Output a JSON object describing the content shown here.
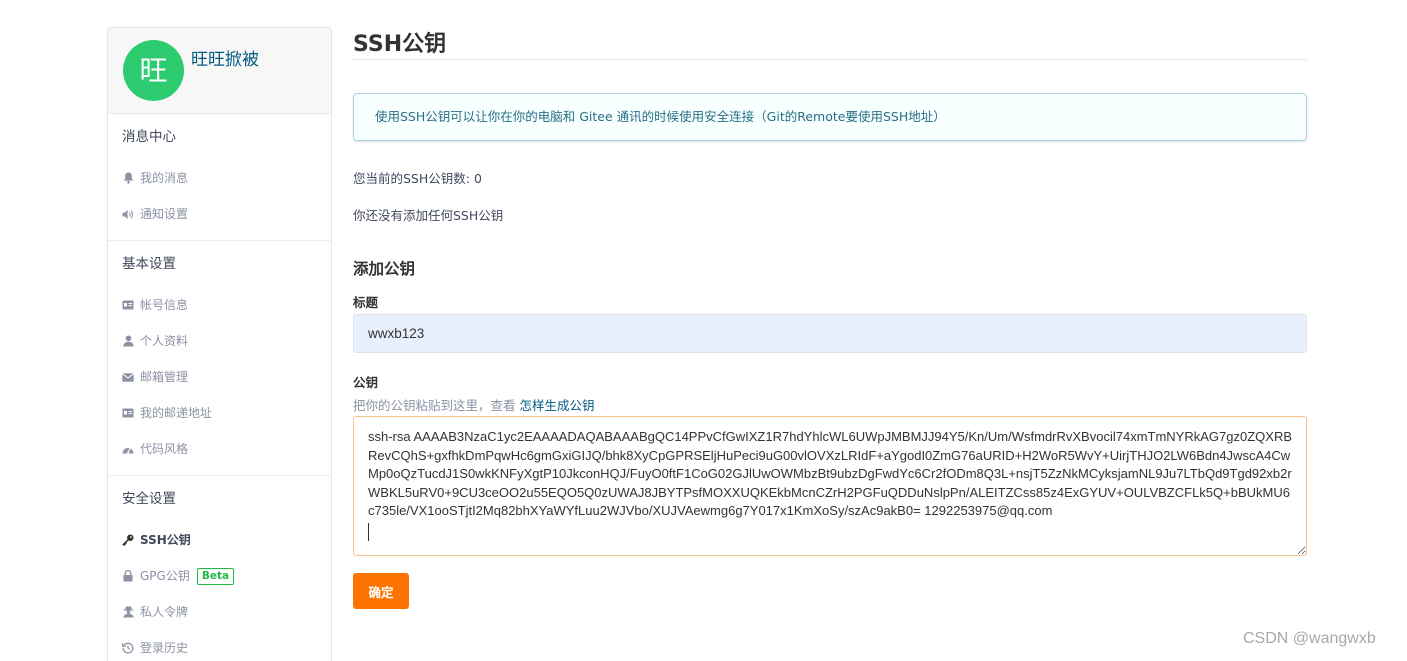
{
  "sidebar": {
    "avatar_text": "旺",
    "username": "旺旺掀被",
    "sections": {
      "messages": {
        "title": "消息中心",
        "items": [
          {
            "label": "我的消息",
            "icon": "bell-icon"
          },
          {
            "label": "通知设置",
            "icon": "speaker-icon"
          }
        ]
      },
      "basic": {
        "title": "基本设置",
        "items": [
          {
            "label": "帐号信息",
            "icon": "id-card-icon"
          },
          {
            "label": "个人资料",
            "icon": "user-icon"
          },
          {
            "label": "邮箱管理",
            "icon": "envelope-icon"
          },
          {
            "label": "我的邮递地址",
            "icon": "address-card-icon"
          },
          {
            "label": "代码风格",
            "icon": "dashboard-icon"
          }
        ]
      },
      "security": {
        "title": "安全设置",
        "items": [
          {
            "label": "SSH公钥",
            "icon": "key-icon",
            "active": true
          },
          {
            "label": "GPG公钥",
            "icon": "lock-icon",
            "badge": "Beta"
          },
          {
            "label": "私人令牌",
            "icon": "user-secret-icon"
          },
          {
            "label": "登录历史",
            "icon": "history-icon"
          }
        ]
      }
    }
  },
  "main": {
    "title": "SSH公钥",
    "info": "使用SSH公钥可以让你在你的电脑和 Gitee 通讯的时候使用安全连接（Git的Remote要使用SSH地址）",
    "count_text": "您当前的SSH公钥数: 0",
    "none_text": "你还没有添加任何SSH公钥",
    "add_title": "添加公钥",
    "form": {
      "title_label": "标题",
      "title_value": "wwxb123",
      "key_label": "公钥",
      "key_hint": "把你的公钥粘贴到这里，查看",
      "key_hint_link": "怎样生成公钥",
      "key_value": "ssh-rsa AAAAB3NzaC1yc2EAAAADAQABAAABgQC14PPvCfGwIXZ1R7hdYhlcWL6UWpJMBMJJ94Y5/Kn/Um/WsfmdrRvXBvocil74xmTmNYRkAG7gz0ZQXRBRevCQhS+gxfhkDmPqwHc6gmGxiGIJQ/bhk8XyCpGPRSEljHuPeci9uG00vlOVXzLRIdF+aYgodI0ZmG76aURID+H2WoR5WvY+UirjTHJO2LW6Bdn4JwscA4CwMp0oQzTucdJ1S0wkKNFyXgtP10JkconHQJ/FuyO0ftF1CoG02GJlUwOWMbzBt9ubzDgFwdYc6Cr2fODm8Q3L+nsjT5ZzNkMCyksjamNL9Ju7LTbQd9Tgd92xb2rWBKL5uRV0+9CU3ceOO2u55EQO5Q0zUWAJ8JBYTPsfMOXXUQKEkbMcnCZrH2PGFuQDDuNslpPn/ALEITZCss85z4ExGYUV+OULVBZCFLk5Q+bBUkMU6c735le/VX1ooSTjtI2Mq82bhXYaWYfLuu2WJVbo/XUJVAewmg6g7Y017x1KmXoSy/szAc9akB0= 1292253975@qq.com",
      "submit_label": "确定"
    }
  },
  "watermark": "CSDN @wangwxb"
}
